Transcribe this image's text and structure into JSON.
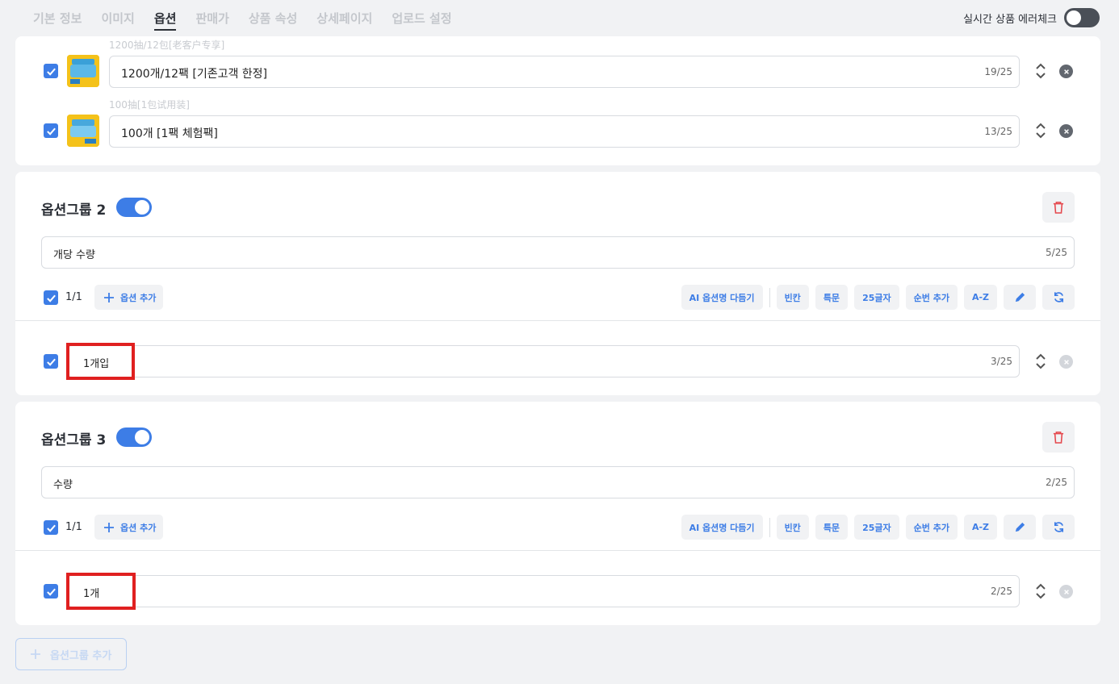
{
  "tabs": [
    "기본 정보",
    "이미지",
    "옵션",
    "판매가",
    "상품 속성",
    "상세페이지",
    "업로드 설정"
  ],
  "active_tab_index": 2,
  "realtime_check": {
    "label": "실시간 상품 에러체크",
    "enabled": false
  },
  "group1": {
    "options": [
      {
        "source_label": "1200抽/12包[老客户专享]",
        "value": "1200개/12팩 [기존고객 한정]",
        "count": "19/25",
        "checked": true
      },
      {
        "source_label": "100抽[1包试用装]",
        "value": "100개 [1팩 체험팩]",
        "count": "13/25",
        "checked": true
      }
    ]
  },
  "group2": {
    "title": "옵션그룹 2",
    "enabled": true,
    "name_value": "개당 수량",
    "name_count": "5/25",
    "selected_count": "1/1",
    "add_option_label": "옵션 추가",
    "toolbar": [
      "AI 옵션명 다듬기",
      "빈칸",
      "특문",
      "25글자",
      "순번 추가",
      "A-Z"
    ],
    "options": [
      {
        "value": "1개입",
        "count": "3/25",
        "checked": true
      }
    ]
  },
  "group3": {
    "title": "옵션그룹 3",
    "enabled": true,
    "name_value": "수량",
    "name_count": "2/25",
    "selected_count": "1/1",
    "add_option_label": "옵션 추가",
    "toolbar": [
      "AI 옵션명 다듬기",
      "빈칸",
      "특문",
      "25글자",
      "순번 추가",
      "A-Z"
    ],
    "options": [
      {
        "value": "1개",
        "count": "2/25",
        "checked": true
      }
    ]
  },
  "add_group_label": "옵션그룹 추가",
  "colors": {
    "accent": "#3d7de6",
    "highlight": "#e02020",
    "danger": "#e5484d"
  },
  "icons": [
    "check-icon",
    "sort-updown-icon",
    "remove-circle-icon",
    "trash-icon",
    "plus-icon",
    "pencil-icon",
    "refresh-icon"
  ]
}
